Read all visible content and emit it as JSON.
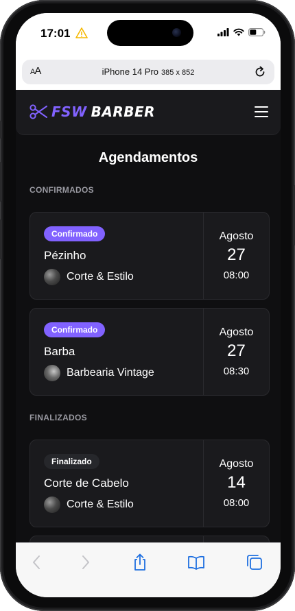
{
  "status_bar": {
    "time": "17:01"
  },
  "browser": {
    "aa_label": "AA",
    "device_name": "iPhone 14 Pro",
    "device_dims": "385 x 852"
  },
  "site": {
    "logo_fsw": "FSW",
    "logo_barber": "BARBER",
    "accent_color": "#8162ff"
  },
  "page": {
    "title": "Agendamentos"
  },
  "sections": {
    "confirmed_label": "CONFIRMADOS",
    "finished_label": "FINALIZADOS"
  },
  "bookings": [
    {
      "status": "Confirmado",
      "service": "Pézinho",
      "shop": "Corte & Estilo",
      "month": "Agosto",
      "day": "27",
      "time": "08:00"
    },
    {
      "status": "Confirmado",
      "service": "Barba",
      "shop": "Barbearia Vintage",
      "month": "Agosto",
      "day": "27",
      "time": "08:30"
    },
    {
      "status": "Finalizado",
      "service": "Corte de Cabelo",
      "shop": "Corte & Estilo",
      "month": "Agosto",
      "day": "14",
      "time": "08:00"
    }
  ],
  "icons": {
    "warning": "warning-icon",
    "signal": "cellular-signal-icon",
    "wifi": "wifi-icon",
    "battery": "battery-icon",
    "reload": "reload-icon",
    "menu": "hamburger-menu-icon",
    "back": "chevron-left-icon",
    "forward": "chevron-right-icon",
    "share": "share-icon",
    "bookmarks": "book-icon",
    "tabs": "tabs-icon"
  }
}
